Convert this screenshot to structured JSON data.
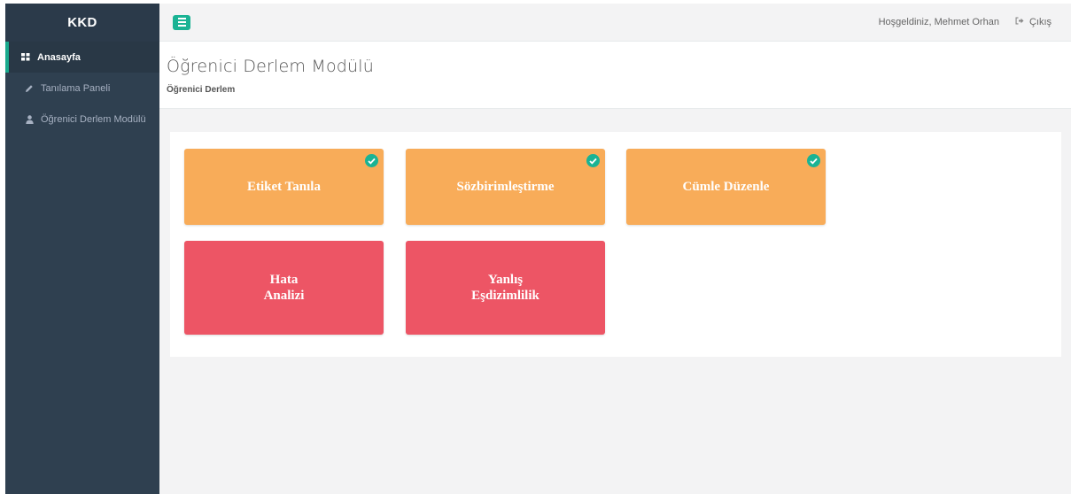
{
  "sidebar": {
    "brand": "KKD",
    "items": [
      {
        "label": "Anasayfa",
        "icon": "grid-icon",
        "active": true
      },
      {
        "label": "Tanılama Paneli",
        "icon": "pencil-icon",
        "active": false
      },
      {
        "label": "Öğrenici Derlem Modülü",
        "icon": "user-icon",
        "active": false
      }
    ]
  },
  "topbar": {
    "menu_icon": "hamburger-icon",
    "welcome": "Hoşgeldiniz, Mehmet Orhan",
    "logout_label": "Çıkış",
    "logout_icon": "sign-out-icon"
  },
  "page": {
    "title": "Öğrenici Derlem Modülü",
    "breadcrumb": "Öğrenici Derlem"
  },
  "cards": [
    {
      "label": "Etiket Tanıla",
      "color": "#f8ac59",
      "completed": true
    },
    {
      "label": "Sözbirimleştirme",
      "color": "#f8ac59",
      "completed": true
    },
    {
      "label": "Cümle Düzenle",
      "color": "#f8ac59",
      "completed": true
    },
    {
      "label_line1": "Hata",
      "label_line2": "Analizi",
      "color": "#ed5565",
      "completed": false
    },
    {
      "label_line1": "Yanlış",
      "label_line2": "Eşdizimlilik",
      "color": "#ed5565",
      "completed": false
    }
  ],
  "colors": {
    "sidebar_bg": "#2f4050",
    "accent": "#1ab394",
    "card_orange": "#f8ac59",
    "card_red": "#ed5565"
  }
}
